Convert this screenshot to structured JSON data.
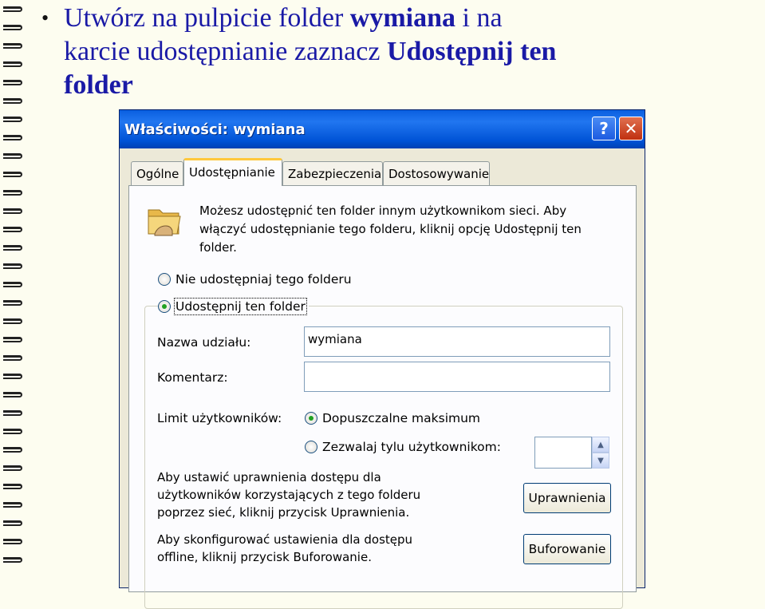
{
  "slide": {
    "bullet_line1_prefix": "Utwórz na pulpicie folder ",
    "bullet_line1_bold": "wymiana",
    "bullet_line1_suffix": " i na",
    "bullet_line2_prefix": "karcie udostępnianie zaznacz ",
    "bullet_line2_bold": "Udostępnij ten",
    "bullet_line3_bold": "folder"
  },
  "dialog": {
    "title": "Właściwości: wymiana",
    "help_glyph": "?",
    "close_glyph": "✕",
    "tabs": [
      "Ogólne",
      "Udostępnianie",
      "Zabezpieczenia",
      "Dostosowywanie"
    ],
    "description": "Możesz udostępnić ten folder innym użytkownikom sieci. Aby włączyć udostępnianie tego folderu, kliknij opcję Udostępnij ten folder.",
    "radio_no_share": "Nie udostępniaj tego folderu",
    "radio_share": "Udostępnij ten folder",
    "share_name_label": "Nazwa udziału:",
    "share_name_value": "wymiana",
    "comment_label": "Komentarz:",
    "comment_value": "",
    "user_limit_label": "Limit użytkowników:",
    "radio_max": "Dopuszczalne maksimum",
    "radio_allow": "Zezwalaj tylu użytkownikom:",
    "permissions_text": "Aby ustawić uprawnienia dostępu dla użytkowników korzystających z tego folderu poprzez sieć, kliknij przycisk Uprawnienia.",
    "permissions_button": "Uprawnienia",
    "caching_text": "Aby skonfigurować ustawienia dla dostępu offline, kliknij przycisk Buforowanie.",
    "caching_button": "Buforowanie"
  },
  "colors": {
    "slide_text": "#1a1aa6",
    "titlebar": "#0053d6",
    "dialog_bg": "#ece9d8"
  }
}
